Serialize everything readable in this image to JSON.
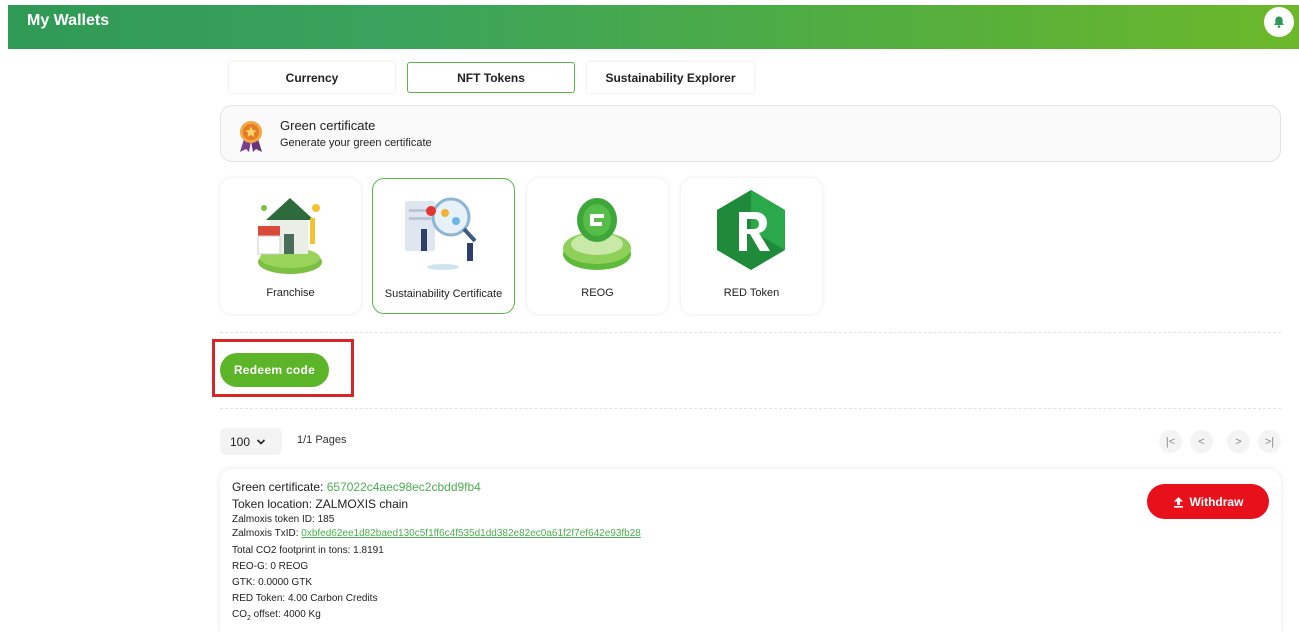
{
  "header": {
    "title": "My Wallets",
    "bell_icon": "bell-icon"
  },
  "tabs": [
    {
      "label": "Currency",
      "active": false
    },
    {
      "label": "NFT Tokens",
      "active": true
    },
    {
      "label": "Sustainability Explorer",
      "active": false
    }
  ],
  "certificate_banner": {
    "icon": "award-medal-icon",
    "title": "Green certificate",
    "subtitle": "Generate your green certificate"
  },
  "nft_cards": [
    {
      "label": "Franchise",
      "icon": "franchise-house-icon",
      "active": false
    },
    {
      "label": "Sustainability Certificate",
      "icon": "sustainability-certificate-icon",
      "active": true
    },
    {
      "label": "REOG",
      "icon": "reog-coin-icon",
      "active": false
    },
    {
      "label": "RED Token",
      "icon": "red-token-hexagon-icon",
      "active": false
    }
  ],
  "redeem": {
    "label": "Redeem code"
  },
  "pagination": {
    "page_size": "100",
    "pages_text": "1/1 Pages",
    "first": "|<",
    "prev": "<",
    "next": ">",
    "last": ">|"
  },
  "token": {
    "certificate_label": "Green certificate: ",
    "certificate_id": "657022c4aec98ec2cbdd9fb4",
    "location": "Token location: ZALMOXIS chain",
    "token_id": "Zalmoxis token ID: 185",
    "txid_label": "Zalmoxis TxID: ",
    "txid": "0xbfed62ee1d82baed130c5f1ff6c4f535d1dd382e82ec0a61f2f7ef642e93fb28",
    "co2_footprint": "Total CO2 footprint in tons: 1.8191",
    "reog": "REO-G: 0 REOG",
    "gtk": "GTK: 0.0000 GTK",
    "red_token": "RED Token: 4.00 Carbon Credits",
    "offset_prefix": "CO",
    "offset_sub": "2",
    "offset_suffix": " offset: 4000 Kg",
    "withdraw_label": "Withdraw"
  },
  "colors": {
    "header_start": "#2f9a55",
    "header_end": "#6cb82a",
    "accent_green": "#5cb529",
    "withdraw_red": "#e8101b",
    "highlight_red": "#d42828"
  }
}
